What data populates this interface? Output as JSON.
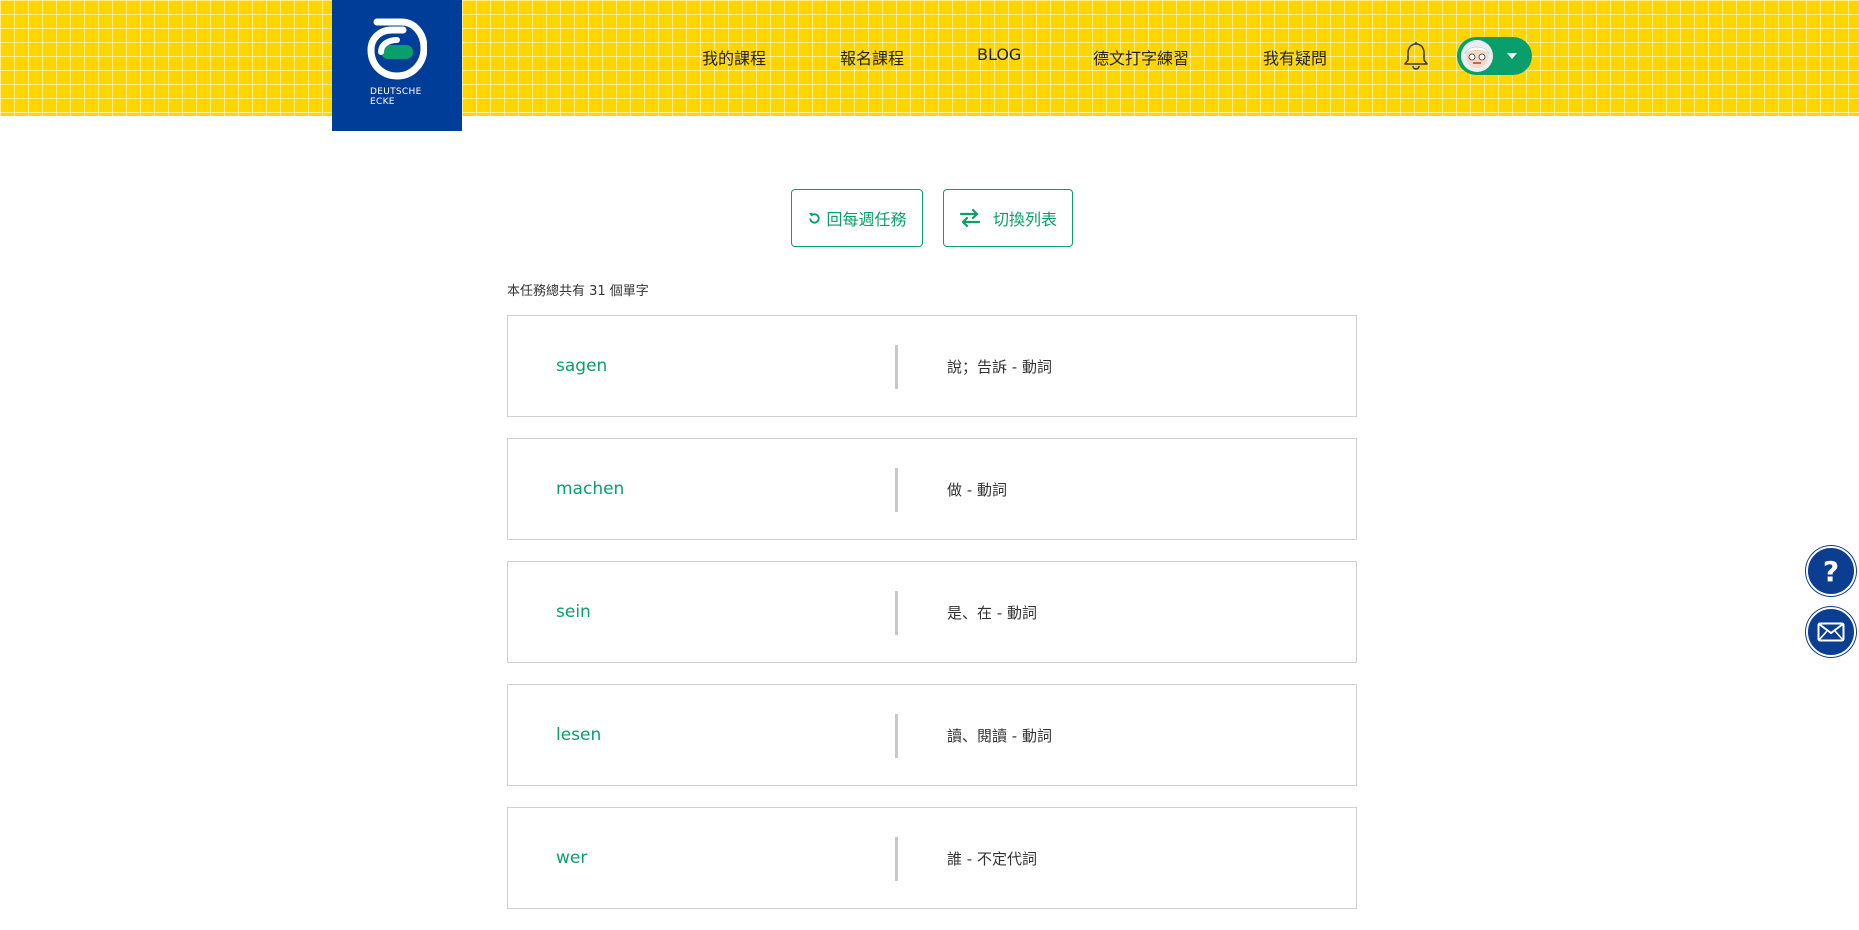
{
  "brand": {
    "line1": "DEUTSCHE",
    "line2": "ECKE",
    "bg_color": "#003d99"
  },
  "nav": {
    "items": [
      "我的課程",
      "報名課程",
      "BLOG",
      "德文打字練習",
      "我有疑問"
    ],
    "bell_icon": "bell-icon",
    "avatar_icon": "user-avatar"
  },
  "actions": {
    "back_label": "回每週任務",
    "back_icon": "refresh-icon",
    "switch_label": "切換列表",
    "switch_icon": "swap-arrows-icon"
  },
  "summary": {
    "count_text": "本任務總共有 31 個單字"
  },
  "words": [
    {
      "de": "sagen",
      "zh": "說；告訴  -  動詞"
    },
    {
      "de": "machen",
      "zh": "做  -  動詞"
    },
    {
      "de": "sein",
      "zh": "是、在  -  動詞"
    },
    {
      "de": "lesen",
      "zh": "讀、閱讀  -  動詞"
    },
    {
      "de": "wer",
      "zh": "誰  -  不定代詞"
    }
  ],
  "floating": {
    "help_icon": "question-icon",
    "mail_icon": "mail-icon"
  },
  "colors": {
    "header_yellow": "#ffd500",
    "accent_green": "#0a9f6a",
    "brand_blue": "#003d99"
  }
}
